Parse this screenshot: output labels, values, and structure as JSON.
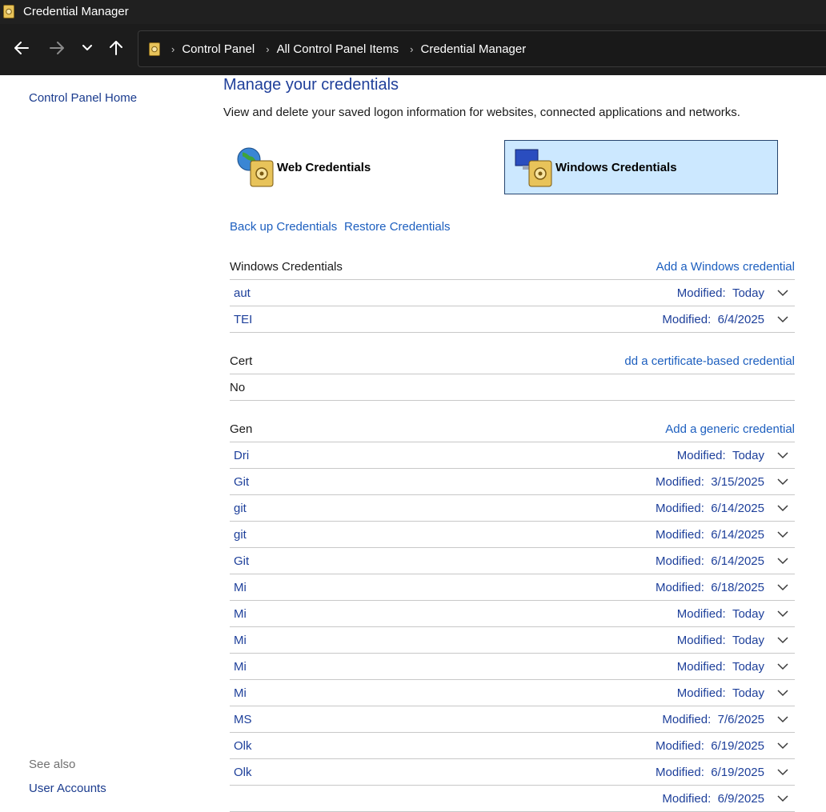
{
  "window": {
    "title": "Credential Manager"
  },
  "address": {
    "crumbs": [
      "Control Panel",
      "All Control Panel Items",
      "Credential Manager"
    ]
  },
  "sidebar": {
    "home_link": "Control Panel Home",
    "see_also_label": "See also",
    "see_also_links": [
      "User Accounts"
    ]
  },
  "main": {
    "heading": "Manage your credentials",
    "description": "View and delete your saved logon information for websites, connected applications and networks.",
    "tiles": {
      "web": "Web Credentials",
      "windows": "Windows Credentials"
    },
    "backup_link": "Back up Credentials",
    "restore_link": "Restore Credentials",
    "windows_section": {
      "title": "Windows Credentials",
      "action": "Add a Windows credential",
      "rows": [
        {
          "name": "aut",
          "modified_label": "Modified:",
          "modified": "Today"
        },
        {
          "name": "TEI",
          "modified_label": "Modified:",
          "modified": "6/4/2025"
        }
      ]
    },
    "cert_section": {
      "title": "Cert",
      "action": "dd a certificate-based credential",
      "empty_text": "No"
    },
    "generic_section": {
      "title": "Gen",
      "action": "Add a generic credential",
      "rows": [
        {
          "name": "Dri",
          "modified_label": "Modified:",
          "modified": "Today"
        },
        {
          "name": "Git",
          "modified_label": "Modified:",
          "modified": "3/15/2025"
        },
        {
          "name": "git",
          "modified_label": "Modified:",
          "modified": "6/14/2025"
        },
        {
          "name": "git",
          "modified_label": "Modified:",
          "modified": "6/14/2025"
        },
        {
          "name": "Git",
          "modified_label": "Modified:",
          "modified": "6/14/2025"
        },
        {
          "name": "Mi",
          "modified_label": "Modified:",
          "modified": "6/18/2025"
        },
        {
          "name": "Mi",
          "modified_label": "Modified:",
          "modified": "Today"
        },
        {
          "name": "Mi",
          "modified_label": "Modified:",
          "modified": "Today"
        },
        {
          "name": "Mi",
          "modified_label": "Modified:",
          "modified": "Today"
        },
        {
          "name": "Mi",
          "modified_label": "Modified:",
          "modified": "Today"
        },
        {
          "name": "MS",
          "modified_label": "Modified:",
          "modified": "7/6/2025"
        },
        {
          "name": "Olk",
          "modified_label": "Modified:",
          "modified": "6/19/2025"
        },
        {
          "name": "Olk",
          "modified_label": "Modified:",
          "modified": "6/19/2025"
        },
        {
          "name": "",
          "modified_label": "Modified:",
          "modified": "6/9/2025"
        }
      ]
    }
  },
  "colors": {
    "selected_tile": "#cce8ff",
    "link": "#1d5fbf",
    "heading": "#1f3f9a",
    "titlebar": "#202020"
  },
  "icons": [
    "credential-manager-icon",
    "back-arrow-icon",
    "forward-arrow-icon",
    "recent-dropdown-icon",
    "up-arrow-icon",
    "chevron-right-icon",
    "globe-vault-icon",
    "monitor-vault-icon",
    "chevron-down-icon"
  ]
}
